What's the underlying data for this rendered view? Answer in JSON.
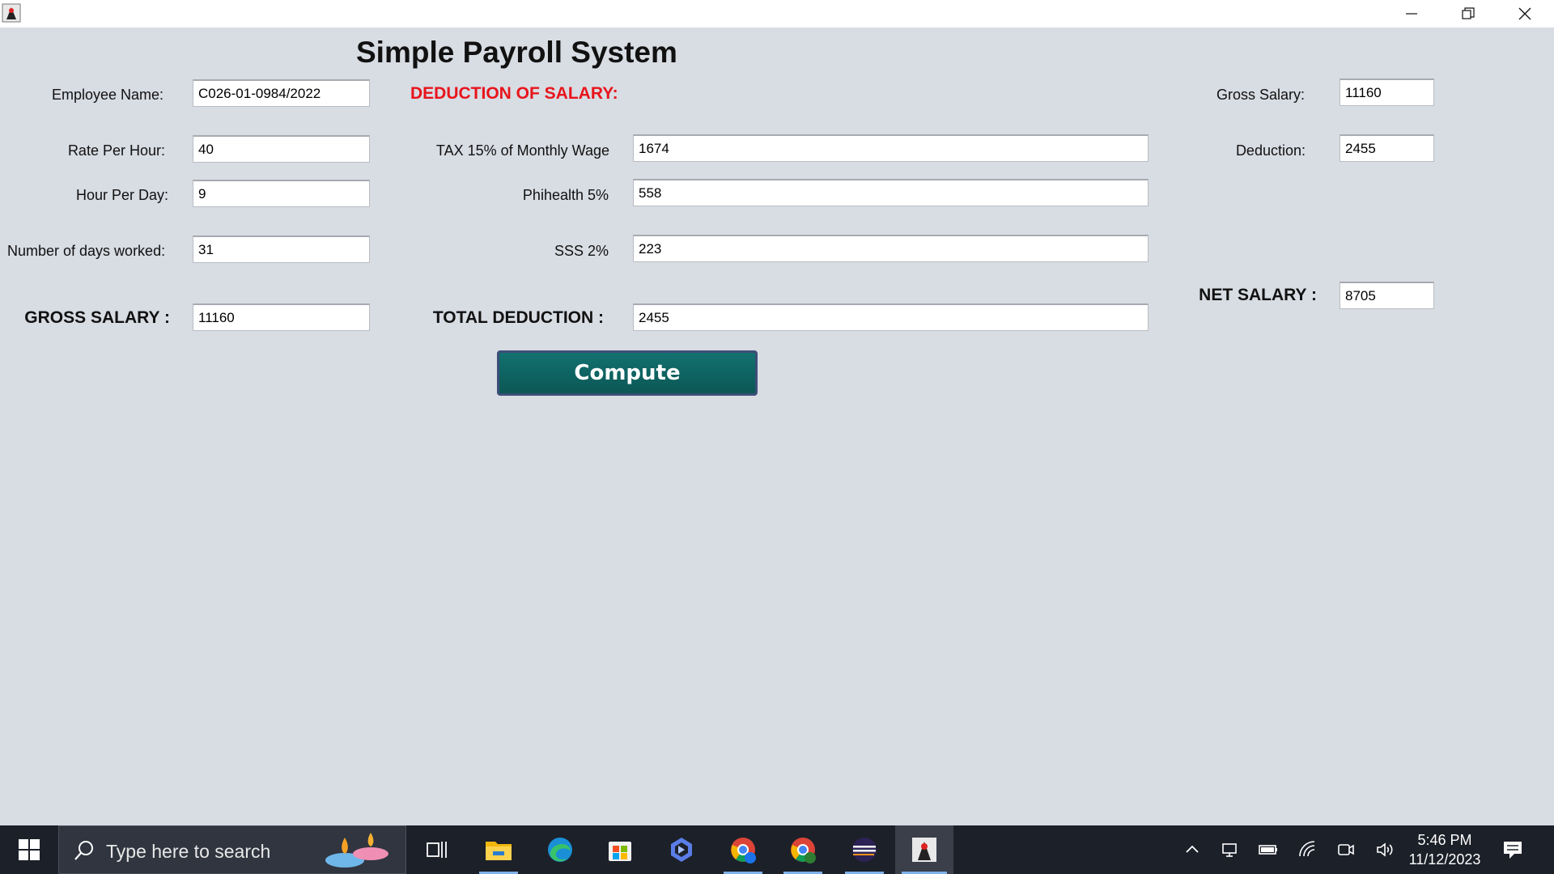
{
  "window": {
    "app_icon": "java-duke-icon",
    "controls": [
      "minimize-icon",
      "restore-icon",
      "close-icon"
    ]
  },
  "title": "Simple Payroll System",
  "employee": {
    "name_label": "Employee Name:",
    "name_value": "C026-01-0984/2022",
    "rate_label": "Rate Per Hour:",
    "rate_value": "40",
    "hours_label": "Hour Per Day:",
    "hours_value": "9",
    "days_label": "Number of days worked:",
    "days_value": "31",
    "gross_label": "GROSS SALARY :",
    "gross_value": "11160"
  },
  "deductions": {
    "header": "DEDUCTION OF SALARY:",
    "tax_label": "TAX 15% of Monthly Wage",
    "tax_value": "1674",
    "philhealth_label": "Phihealth 5%",
    "philhealth_value": "558",
    "sss_label": "SSS 2%",
    "sss_value": "223",
    "total_label": "TOTAL DEDUCTION :",
    "total_value": "2455"
  },
  "summary": {
    "gross_label": "Gross Salary:",
    "gross_value": "11160",
    "deduction_label": "Deduction:",
    "deduction_value": "2455",
    "net_label": "NET SALARY :",
    "net_value": "8705"
  },
  "compute_button": "Compute",
  "colors": {
    "background": "#d8dce3",
    "deduction_header": "#e8141c",
    "button": "#0e6563",
    "taskbar": "#1c2029"
  },
  "taskbar": {
    "search_placeholder": "Type here to search",
    "apps": [
      "task-view-icon",
      "file-explorer-icon",
      "edge-icon",
      "microsoft-store-icon",
      "copilot-icon",
      "chrome-icon",
      "chrome-icon",
      "eclipse-icon",
      "java-duke-icon"
    ],
    "time": "5:46 PM",
    "date": "11/12/2023"
  }
}
